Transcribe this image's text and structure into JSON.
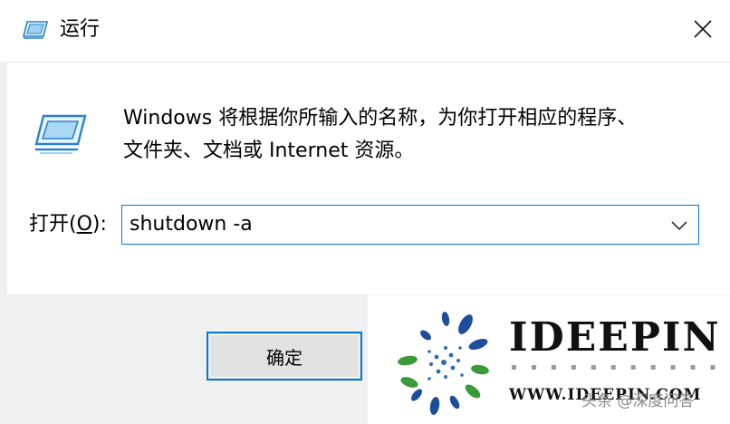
{
  "window": {
    "title": "运行",
    "icon": "run-icon",
    "close_icon": "close-icon"
  },
  "content": {
    "description_line1": "Windows 将根据你所输入的名称，为你打开相应的程序、",
    "description_line2": "文件夹、文档或 Internet 资源。",
    "open_label_prefix": "打开(",
    "open_label_key": "O",
    "open_label_suffix": "):",
    "open_value": "shutdown -a",
    "dropdown_icon": "chevron-down-icon"
  },
  "buttons": {
    "ok_label": "确定"
  },
  "watermark": {
    "brand": "IDEEPIN",
    "url": "WWW.IDEEPIN.COM",
    "source": "头条 @深度问答"
  },
  "colors": {
    "accent": "#0078d7",
    "button_bg": "#e1e1e1",
    "dialog_bg": "#f0f0f0"
  }
}
